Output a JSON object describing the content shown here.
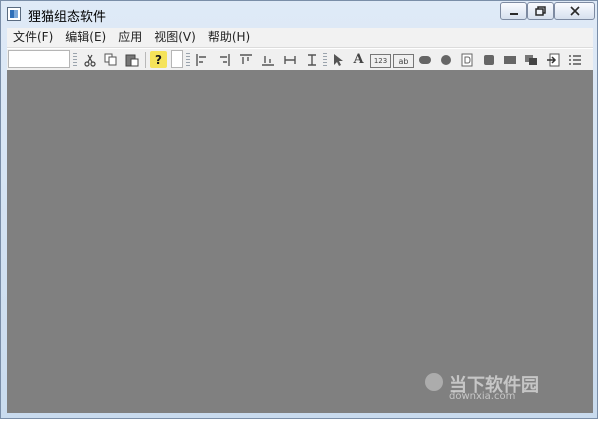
{
  "window": {
    "title": "狸猫组态软件"
  },
  "menu": {
    "file": "文件(F)",
    "edit": "编辑(E)",
    "apply": "应用",
    "view": "视图(V)",
    "help": "帮助(H)"
  },
  "toolbar": {
    "text_tool_label": "A",
    "help_label": "?",
    "number_tool_label": "123",
    "edit_text_tool_label": "ab"
  },
  "watermark": {
    "cn": "当下软件园",
    "en": "downxia.com"
  }
}
